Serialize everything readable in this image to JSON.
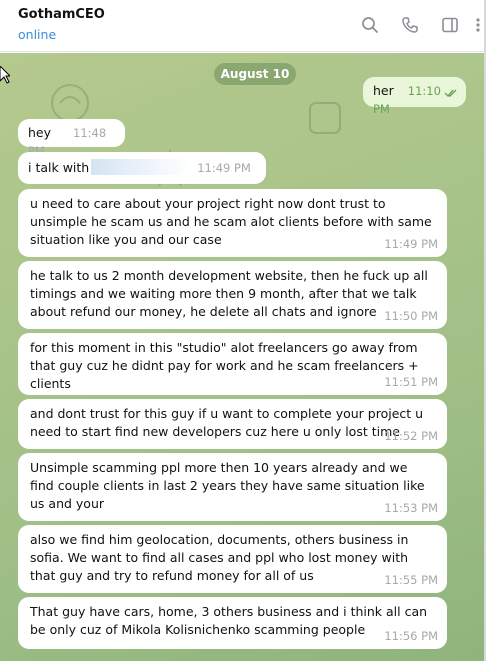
{
  "header": {
    "contact_name": "GothamCEO",
    "status": "online",
    "icons": [
      "search-icon",
      "phone-icon",
      "sidebar-icon",
      "more-icon"
    ]
  },
  "chat": {
    "date_label": "August 10",
    "messages": [
      {
        "direction": "out",
        "text": "her",
        "time": "11:10 PM",
        "read": true
      },
      {
        "direction": "in",
        "text": "hey",
        "time": "11:48 PM"
      },
      {
        "direction": "in",
        "text": "i talk with",
        "time": "11:49 PM",
        "redacted": true
      },
      {
        "direction": "in",
        "text": "u need to care about your project right now dont trust to unsimple he scam us and he scam alot clients before with same situation like you and our case",
        "time": "11:49 PM"
      },
      {
        "direction": "in",
        "text": "he talk to us 2 month development website, then he fuck up all timings and we waiting more then 9 month, after that we talk about refund our money, he delete all chats and ignore",
        "time": "11:50 PM"
      },
      {
        "direction": "in",
        "text": "for this moment in this \"studio\" alot freelancers go away from that guy cuz he didnt pay for work and he scam freelancers + clients",
        "time": "11:51 PM"
      },
      {
        "direction": "in",
        "text": "and dont trust for this guy if u want to complete your project u need to start find new developers cuz here u only lost time",
        "time": "11:52 PM"
      },
      {
        "direction": "in",
        "text": "Unsimple scamming ppl more then 10 years already and we find couple clients in last 2 years they have same situation like us and your",
        "time": "11:53 PM"
      },
      {
        "direction": "in",
        "text": "also we find him geolocation, documents, others business in sofia. We want to find all cases and ppl who lost money with that guy and try to refund money for all of us",
        "time": "11:55 PM"
      },
      {
        "direction": "in",
        "text": "That guy have cars, home, 3 others business and i think all can be only cuz of Mikola Kolisnichenko scamming people",
        "time": "11:56 PM"
      }
    ]
  },
  "colors": {
    "accent": "#3a8fd6",
    "incoming_bubble": "#ffffff",
    "outgoing_bubble": "#eaf6d9",
    "chat_background": "#a9c48a"
  }
}
